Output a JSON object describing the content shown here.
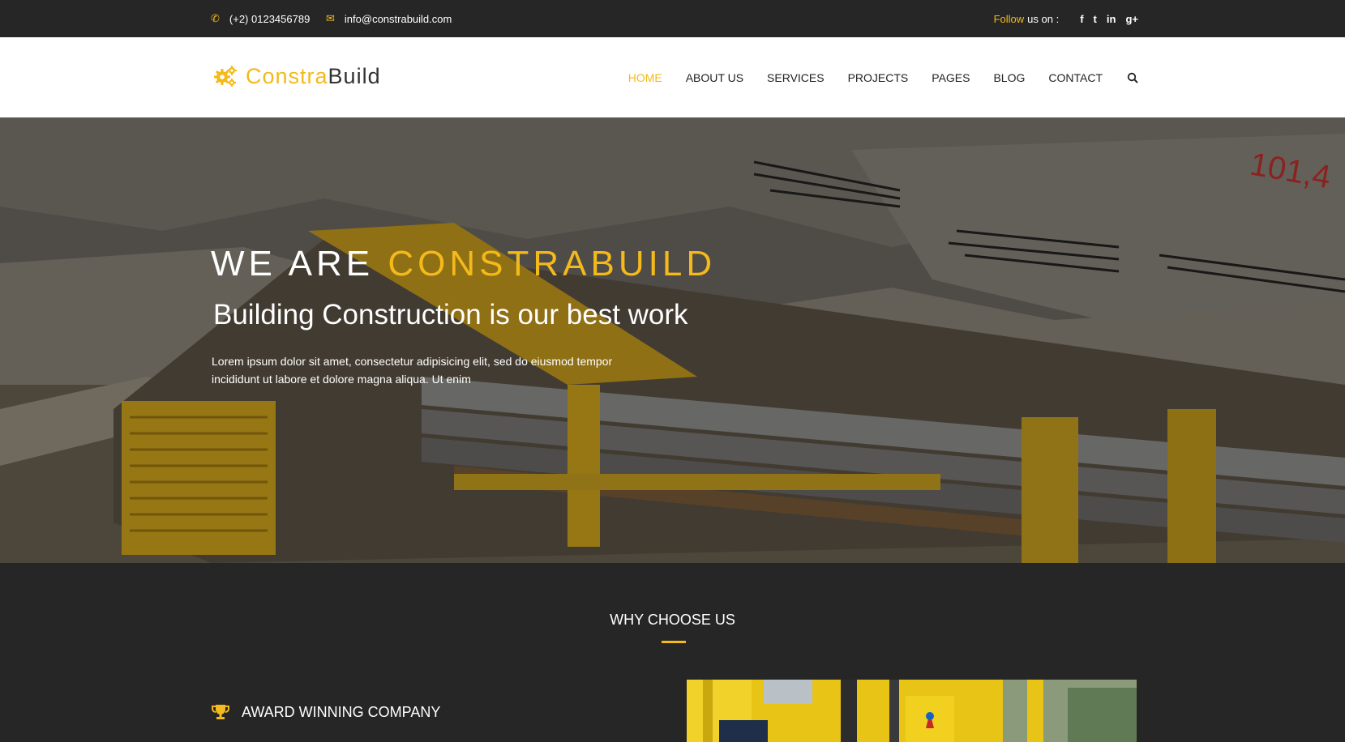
{
  "topbar": {
    "phone": "(+2) 0123456789",
    "email": "info@constrabuild.com",
    "follow_highlight": "Follow",
    "follow_rest": "us on :",
    "social": [
      "f",
      "t",
      "in",
      "g+"
    ]
  },
  "logo": {
    "part1": "Constra",
    "part2": "Build"
  },
  "nav": {
    "items": [
      "HOME",
      "ABOUT US",
      "SERVICES",
      "PROJECTS",
      "PAGES",
      "BLOG",
      "CONTACT"
    ]
  },
  "hero": {
    "title_white": "WE ARE ",
    "title_yellow": "CONSTRABUILD",
    "subtitle": "Building Construction is our best work",
    "text": "Lorem ipsum dolor sit amet, consectetur adipisicing elit, sed do eiusmod tempor incididunt ut labore et dolore magna aliqua. Ut enim"
  },
  "why": {
    "heading": "WHY CHOOSE US",
    "feature_1": "AWARD WINNING COMPANY"
  },
  "colors": {
    "accent": "#f4b91a",
    "dark": "#262626"
  },
  "icons": [
    "phone-icon",
    "envelope-icon",
    "facebook-icon",
    "twitter-icon",
    "linkedin-icon",
    "google-plus-icon",
    "search-icon",
    "gears-logo-icon",
    "trophy-icon"
  ]
}
